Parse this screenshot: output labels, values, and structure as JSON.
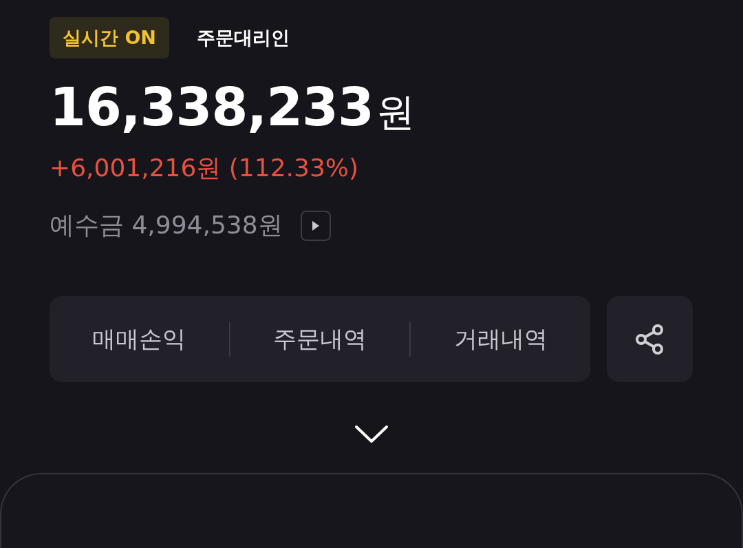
{
  "header": {
    "realtime_badge": "실시간 ON",
    "agent_link": "주문대리인"
  },
  "balance": {
    "amount": "16,338,233",
    "unit": "원"
  },
  "profit": {
    "text": "+6,001,216원 (112.33%)"
  },
  "deposit": {
    "label": "예수금",
    "amount": "4,994,538원"
  },
  "actions": [
    {
      "label": "매매손익"
    },
    {
      "label": "주문내역"
    },
    {
      "label": "거래내역"
    }
  ],
  "expand": {
    "expanded": false
  }
}
